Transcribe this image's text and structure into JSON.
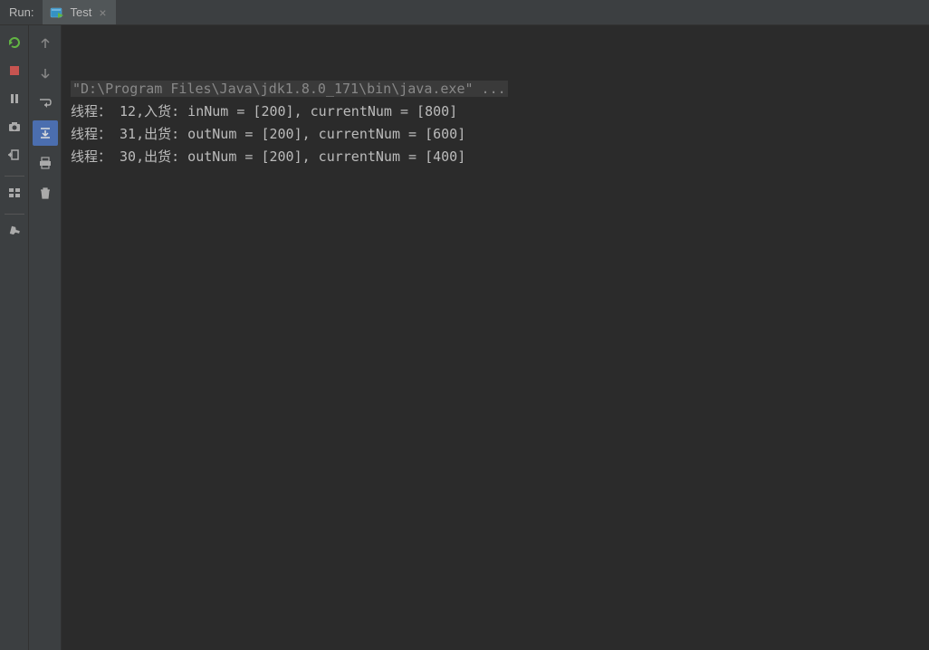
{
  "header": {
    "run_label": "Run:",
    "tab_label": "Test"
  },
  "console": {
    "command": "\"D:\\Program Files\\Java\\jdk1.8.0_171\\bin\\java.exe\" ...",
    "lines": [
      "线程： 12,入货: inNum = [200], currentNum = [800]",
      "线程： 31,出货: outNum = [200], currentNum = [600]",
      "线程： 30,出货: outNum = [200], currentNum = [400]"
    ]
  }
}
